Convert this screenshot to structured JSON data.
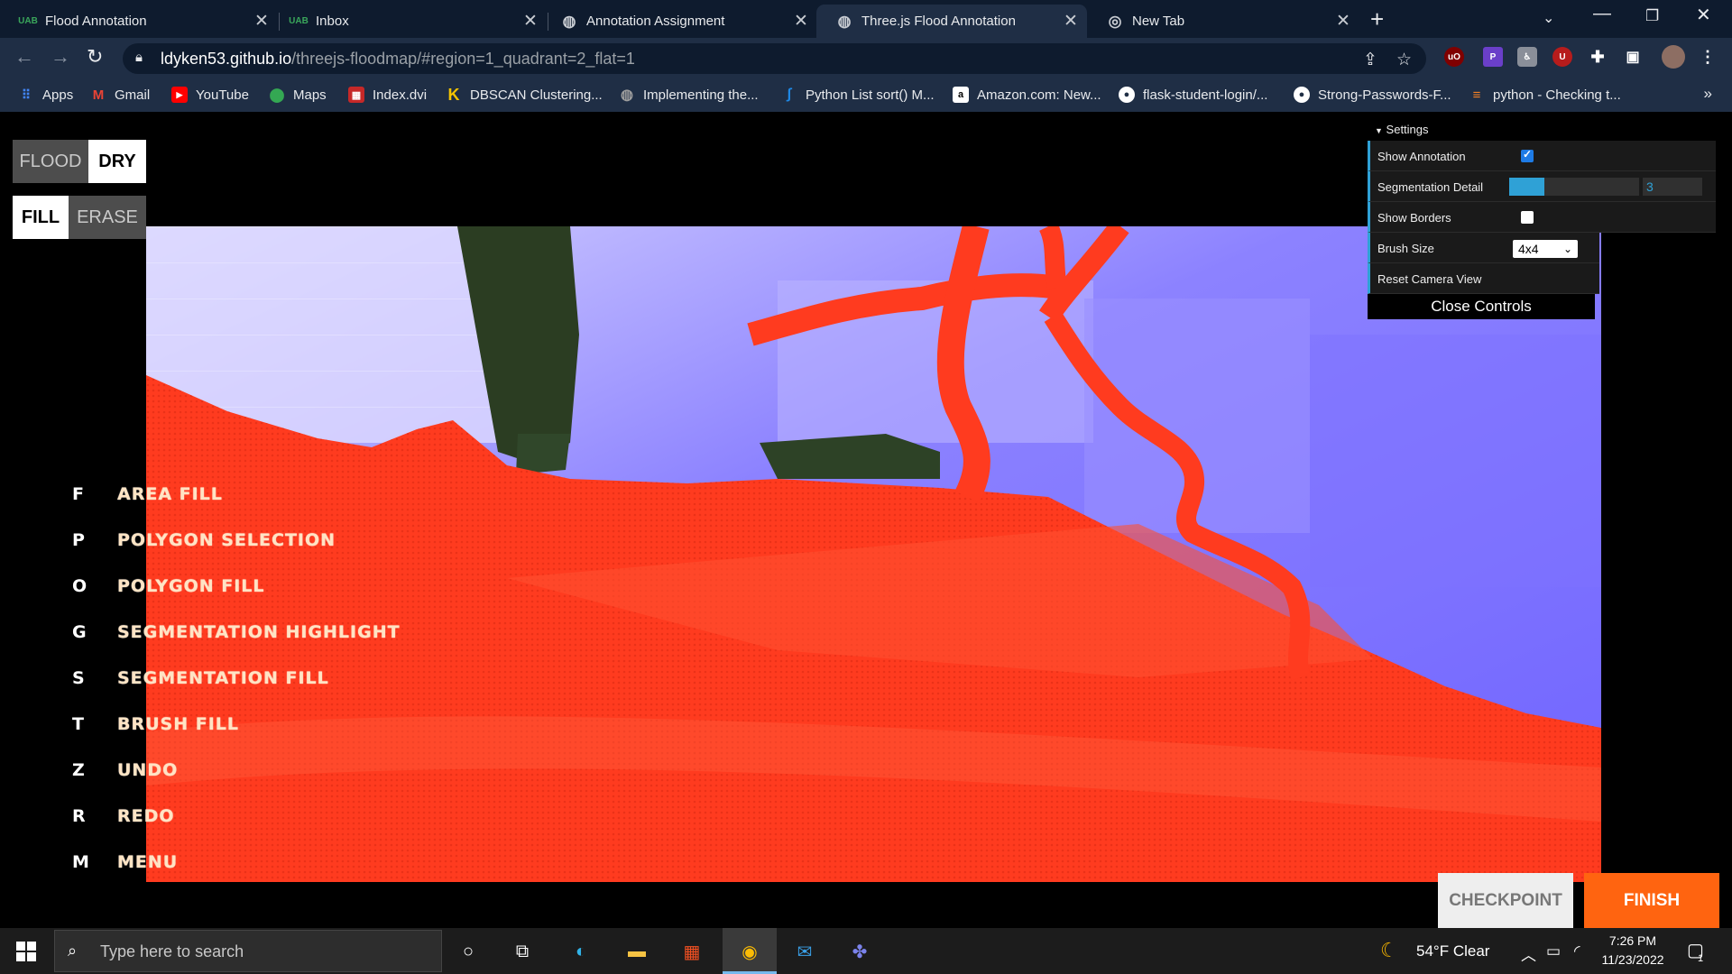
{
  "browser": {
    "tabs": [
      {
        "title": "Flood Annotation",
        "favicon": "uab-icon",
        "active": false
      },
      {
        "title": "Inbox",
        "favicon": "uab-icon",
        "active": false
      },
      {
        "title": "Annotation Assignment",
        "favicon": "globe-icon",
        "active": false
      },
      {
        "title": "Three.js Flood Annotation",
        "favicon": "globe-icon",
        "active": true
      },
      {
        "title": "New Tab",
        "favicon": "chrome-icon",
        "active": false
      }
    ],
    "url_host": "ldyken53.github.io",
    "url_path": "/threejs-floodmap/#region=1_quadrant=2_flat=1",
    "bookmarks": [
      {
        "label": "Apps",
        "icon": "apps-grid-icon",
        "color": "#4285f4"
      },
      {
        "label": "Gmail",
        "icon": "gmail-icon",
        "color": "#ea4335"
      },
      {
        "label": "YouTube",
        "icon": "youtube-icon",
        "color": "#ff0000"
      },
      {
        "label": "Maps",
        "icon": "maps-pin-icon",
        "color": "#34a853"
      },
      {
        "label": "Index.dvi",
        "icon": "document-icon",
        "color": "#c62828"
      },
      {
        "label": "DBSCAN Clustering...",
        "icon": "k-logo-icon",
        "color": "#f5c400"
      },
      {
        "label": "Implementing the...",
        "icon": "globe-icon",
        "color": "#9e9e9e"
      },
      {
        "label": "Python List sort() M...",
        "icon": "feather-icon",
        "color": "#1e88e5"
      },
      {
        "label": "Amazon.com: New...",
        "icon": "amazon-icon",
        "color": "#ffffff"
      },
      {
        "label": "flask-student-login/...",
        "icon": "github-icon",
        "color": "#ffffff"
      },
      {
        "label": "Strong-Passwords-F...",
        "icon": "github-icon",
        "color": "#ffffff"
      },
      {
        "label": "python - Checking t...",
        "icon": "stackoverflow-icon",
        "color": "#f48024"
      }
    ]
  },
  "app": {
    "label_modes": [
      "FLOOD",
      "DRY"
    ],
    "active_label": "DRY",
    "tool_modes": [
      "FILL",
      "ERASE"
    ],
    "active_tool": "FILL",
    "shortcuts": [
      {
        "key": "F",
        "label": "AREA FILL"
      },
      {
        "key": "P",
        "label": "POLYGON SELECTION"
      },
      {
        "key": "O",
        "label": "POLYGON FILL"
      },
      {
        "key": "G",
        "label": "SEGMENTATION HIGHLIGHT"
      },
      {
        "key": "S",
        "label": "SEGMENTATION FILL"
      },
      {
        "key": "T",
        "label": "BRUSH FILL"
      },
      {
        "key": "Z",
        "label": "UNDO"
      },
      {
        "key": "R",
        "label": "REDO"
      },
      {
        "key": "M",
        "label": "MENU"
      }
    ],
    "settings": {
      "title": "Settings",
      "show_annotation_label": "Show Annotation",
      "show_annotation": true,
      "segmentation_detail_label": "Segmentation Detail",
      "segmentation_detail_value": "3",
      "segmentation_detail_fraction": 0.27,
      "show_borders_label": "Show Borders",
      "show_borders": false,
      "brush_size_label": "Brush Size",
      "brush_size_value": "4x4",
      "reset_camera_label": "Reset Camera View",
      "close_label": "Close Controls"
    },
    "checkpoint_label": "CHECKPOINT",
    "finish_label": "FINISH",
    "colors": {
      "flood": "#ff3b1f",
      "dry": "#6c5cff",
      "finish": "#ff6410",
      "gui_accent": "#2fa1d6"
    }
  },
  "taskbar": {
    "search_placeholder": "Type here to search",
    "weather": "54°F  Clear",
    "time": "7:26 PM",
    "date": "11/23/2022",
    "notifications": "1"
  }
}
